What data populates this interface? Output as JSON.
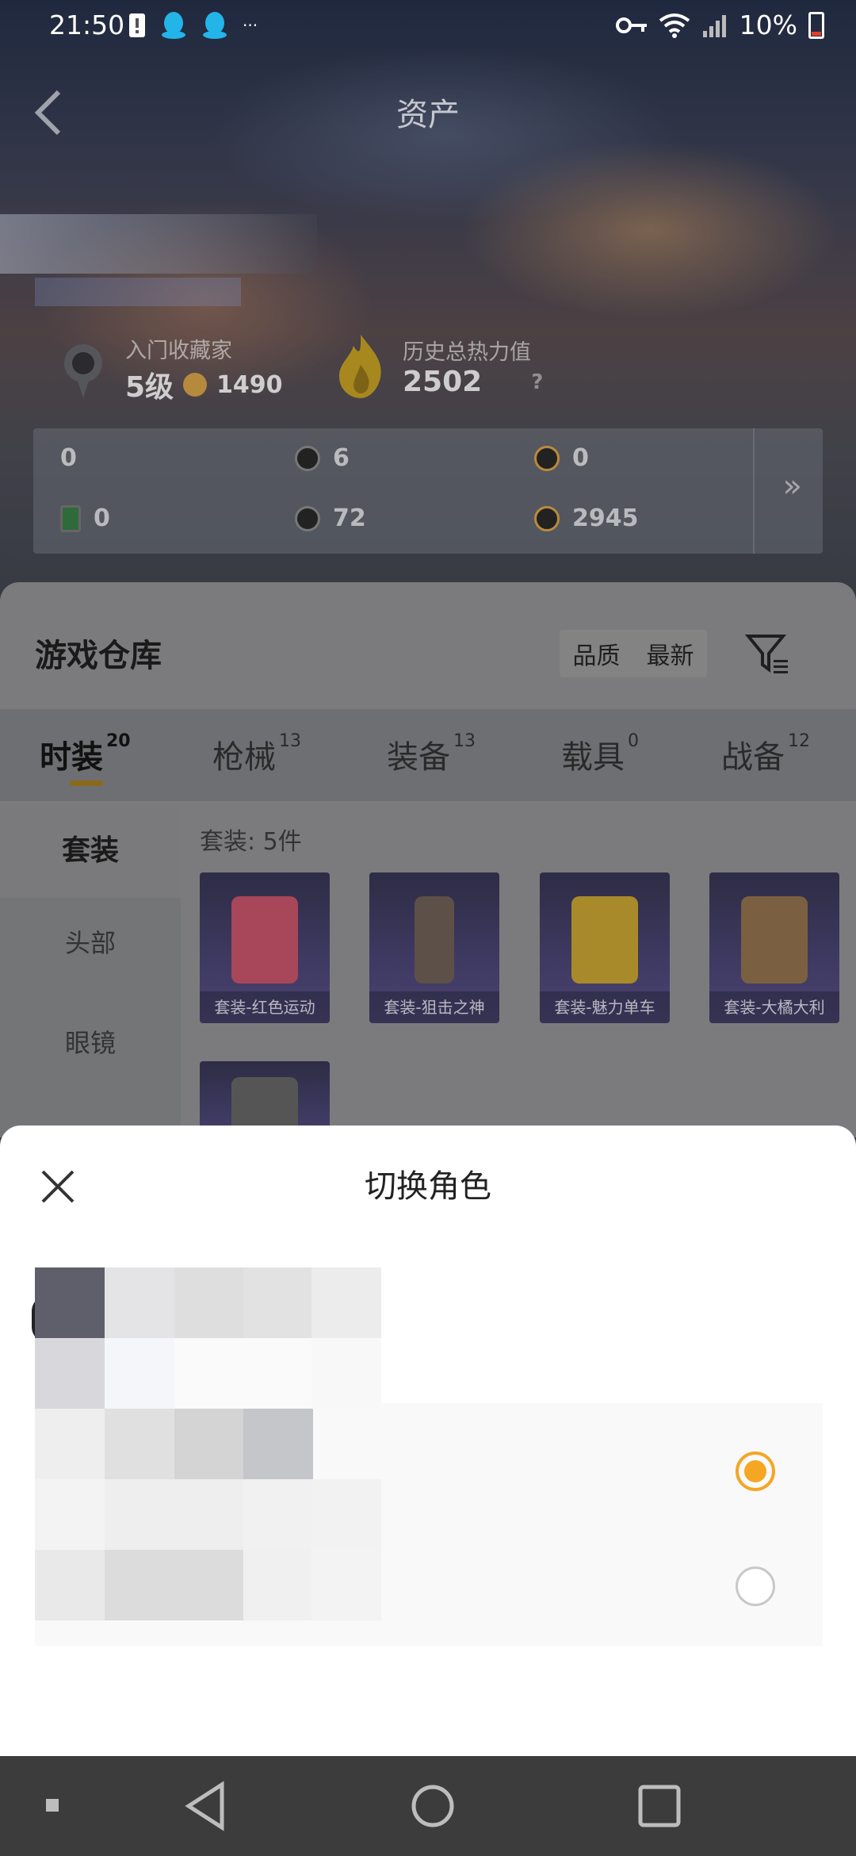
{
  "status_bar": {
    "time": "21:50",
    "dots": "···",
    "battery": "10%",
    "icons": [
      "alert-icon",
      "qq-icon",
      "qq-icon",
      "key-icon",
      "wifi-icon",
      "signal-icon",
      "battery-icon"
    ]
  },
  "header": {
    "title": "资产",
    "back_icon": "back-arrow-icon"
  },
  "profile": {
    "collector_label": "入门收藏家",
    "level": "5级",
    "collector_points": "1490",
    "heat_label": "历史总热力值",
    "heat_value": "2502",
    "help": "?"
  },
  "assets": {
    "items": [
      {
        "value": "0",
        "icon": "purple-card-icon"
      },
      {
        "value": "6",
        "icon": "silver-coin-icon"
      },
      {
        "value": "0",
        "icon": "gold-token-icon"
      },
      {
        "value": "0",
        "icon": "green-card-icon"
      },
      {
        "value": "72",
        "icon": "dark-coin-icon"
      },
      {
        "value": "2945",
        "icon": "gold-coin-icon"
      }
    ],
    "more": "»"
  },
  "warehouse": {
    "title": "游戏仓库",
    "sort_options": [
      "品质",
      "最新"
    ],
    "tabs": [
      {
        "label": "时装",
        "count": "20"
      },
      {
        "label": "枪械",
        "count": "13"
      },
      {
        "label": "装备",
        "count": "13"
      },
      {
        "label": "载具",
        "count": "0"
      },
      {
        "label": "战备",
        "count": "12"
      }
    ],
    "side_items": [
      "套装",
      "头部",
      "眼镜"
    ],
    "content_label": "套装: 5件",
    "cards": [
      "套装-红色运动",
      "套装-狙击之神",
      "套装-魅力单车",
      "套装-大橘大利"
    ]
  },
  "sheet": {
    "title": "切换角色",
    "partial_text": ")",
    "roles": [
      {
        "selected": true
      },
      {
        "selected": false
      }
    ]
  },
  "colors": {
    "accent": "#f5a623",
    "sheet_bg": "#ffffff",
    "nav_bg": "#3c3c3c"
  }
}
